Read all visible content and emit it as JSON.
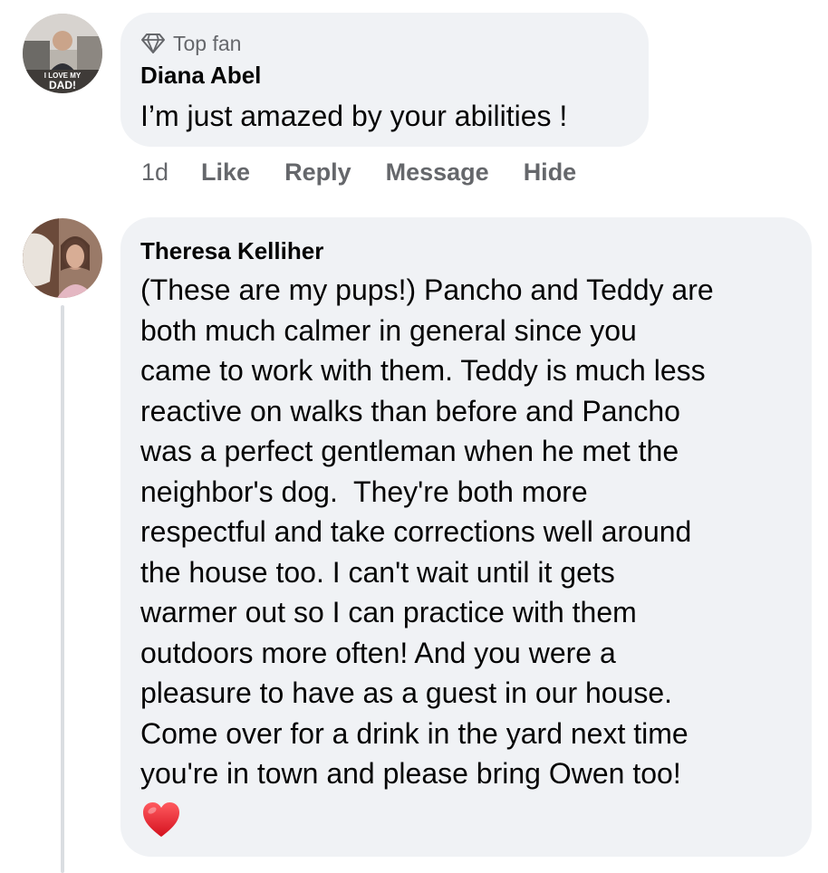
{
  "comments": [
    {
      "badge": "Top fan",
      "author": "Diana Abel",
      "text_lines": [
        "I’m just amazed by your abilities !"
      ],
      "avatar_caption_top": "I LOVE MY",
      "avatar_caption_bottom": "DAD!",
      "actions": {
        "time": "1d",
        "like": "Like",
        "reply": "Reply",
        "message": "Message",
        "hide": "Hide"
      }
    },
    {
      "author": "Theresa Kelliher",
      "text_lines": [
        "(These are my pups!) Pancho and Teddy are",
        "both much calmer in general since you",
        "came to work with them. Teddy is much less",
        "reactive on walks than before and Pancho",
        "was a perfect gentleman when he met the",
        "neighbor's dog.  They're both more",
        "respectful and take corrections well around",
        "the house too. I can't wait until it gets",
        "warmer out so I can practice with them",
        "outdoors more often! And you were a",
        "pleasure to have as a guest in our house.",
        "Come over for a drink in the yard next time",
        "you're in town and please bring Owen too!"
      ],
      "emoji": "red-heart"
    }
  ],
  "colors": {
    "bubble": "#f0f2f5",
    "secondary_text": "#65676b",
    "primary_text": "#050505",
    "heart": "#e8202f"
  }
}
